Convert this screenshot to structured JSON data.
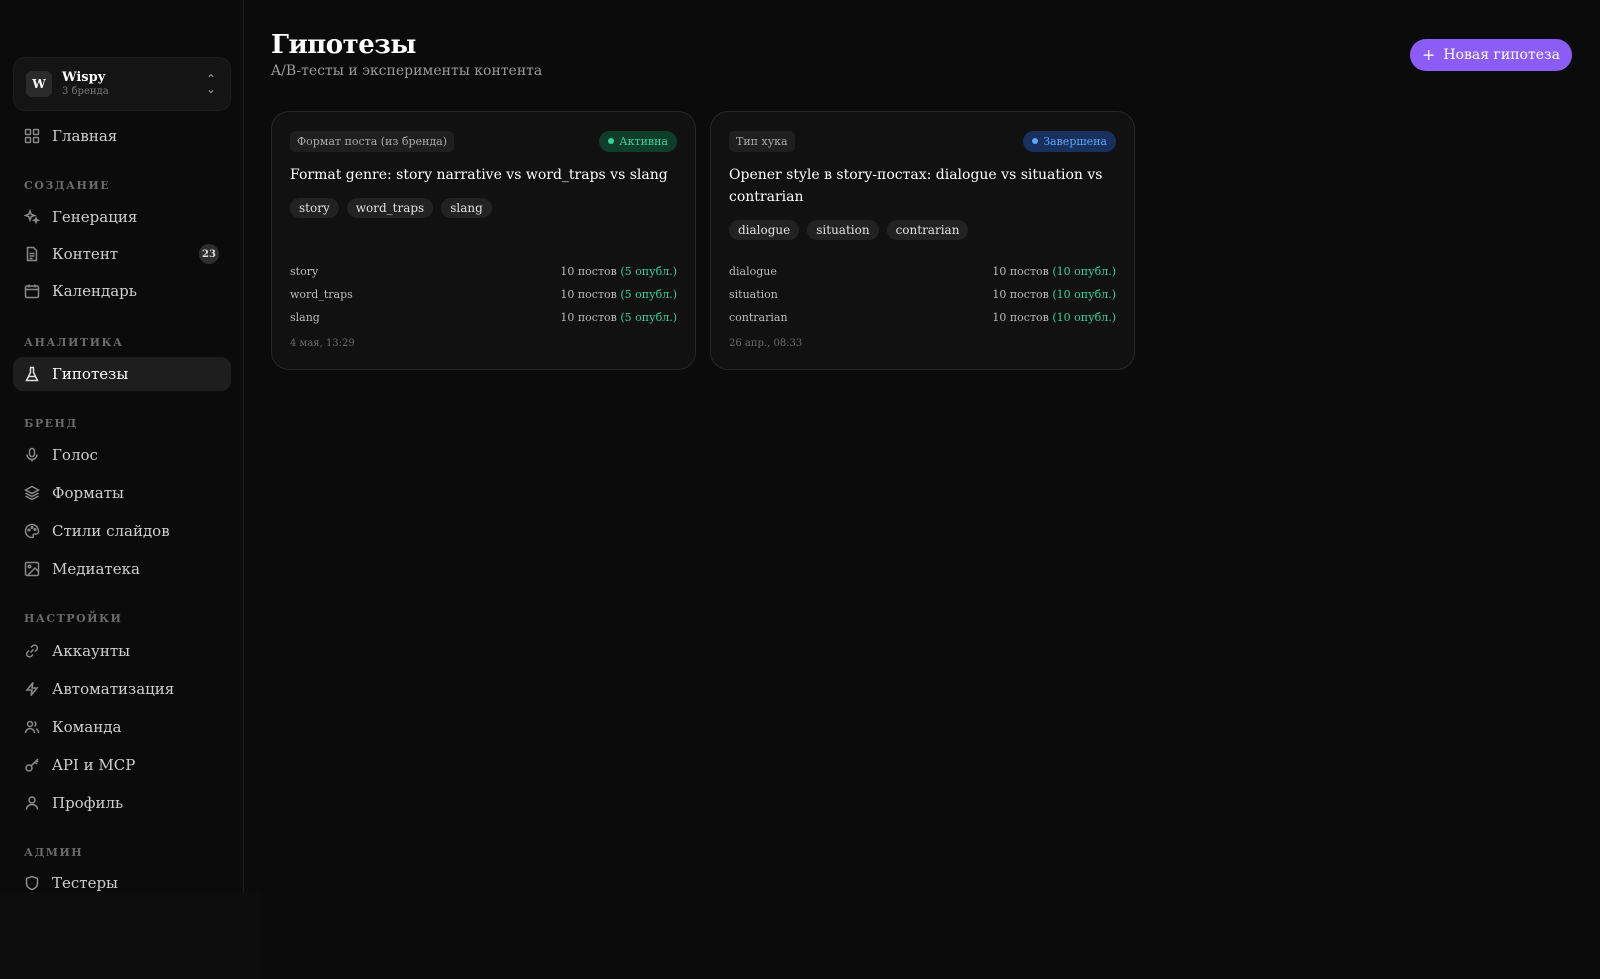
{
  "brand": {
    "initial": "W",
    "name": "Wispy",
    "subtitle": "3 бренда"
  },
  "sidebar": {
    "home": {
      "label": "Главная",
      "icon": "grid-icon"
    },
    "sections": [
      {
        "title": "СОЗДАНИЕ",
        "items": [
          {
            "label": "Генерация",
            "icon": "sparkles-icon"
          },
          {
            "label": "Контент",
            "icon": "document-icon",
            "badge": "23"
          },
          {
            "label": "Календарь",
            "icon": "calendar-icon"
          }
        ]
      },
      {
        "title": "АНАЛИТИКА",
        "items": [
          {
            "label": "Гипотезы",
            "icon": "flask-icon",
            "active": true
          }
        ]
      },
      {
        "title": "БРЕНД",
        "items": [
          {
            "label": "Голос",
            "icon": "microphone-icon"
          },
          {
            "label": "Форматы",
            "icon": "layers-icon"
          },
          {
            "label": "Стили слайдов",
            "icon": "palette-icon"
          },
          {
            "label": "Медиатека",
            "icon": "image-icon"
          }
        ]
      },
      {
        "title": "НАСТРОЙКИ",
        "items": [
          {
            "label": "Аккаунты",
            "icon": "link-icon"
          },
          {
            "label": "Автоматизация",
            "icon": "bolt-icon"
          },
          {
            "label": "Команда",
            "icon": "users-icon"
          },
          {
            "label": "API и MCP",
            "icon": "key-icon"
          },
          {
            "label": "Профиль",
            "icon": "user-icon"
          }
        ]
      },
      {
        "title": "АДМИН",
        "items": [
          {
            "label": "Тестеры",
            "icon": "shield-icon"
          }
        ]
      }
    ]
  },
  "page": {
    "title": "Гипотезы",
    "subtitle": "A/B-тесты и эксперименты контента",
    "new_button_label": "Новая гипотеза"
  },
  "cards": [
    {
      "type_label": "Формат поста (из бренда)",
      "status": "Активна",
      "title": "Format genre: story narrative vs word_traps vs slang",
      "tags": [
        "story",
        "word_traps",
        "slang"
      ],
      "variants": [
        {
          "name": "story",
          "count": "10 постов",
          "published": "(5 опубл.)"
        },
        {
          "name": "word_traps",
          "count": "10 постов",
          "published": "(5 опубл.)"
        },
        {
          "name": "slang",
          "count": "10 постов",
          "published": "(5 опубл.)"
        }
      ],
      "date": "4 мая, 13:29"
    },
    {
      "type_label": "Тип хука",
      "status": "Завершена",
      "title": "Opener style в story-постах: dialogue vs situation vs contrarian",
      "tags": [
        "dialogue",
        "situation",
        "contrarian"
      ],
      "variants": [
        {
          "name": "dialogue",
          "count": "10 постов",
          "published": "(10 опубл.)"
        },
        {
          "name": "situation",
          "count": "10 постов",
          "published": "(10 опубл.)"
        },
        {
          "name": "contrarian",
          "count": "10 постов",
          "published": "(10 опубл.)"
        }
      ],
      "date": "26 апр., 08:33"
    }
  ],
  "colors": {
    "accent": "#8b5cf6",
    "active_green": "#34d399",
    "done_blue": "#60a5fa"
  }
}
